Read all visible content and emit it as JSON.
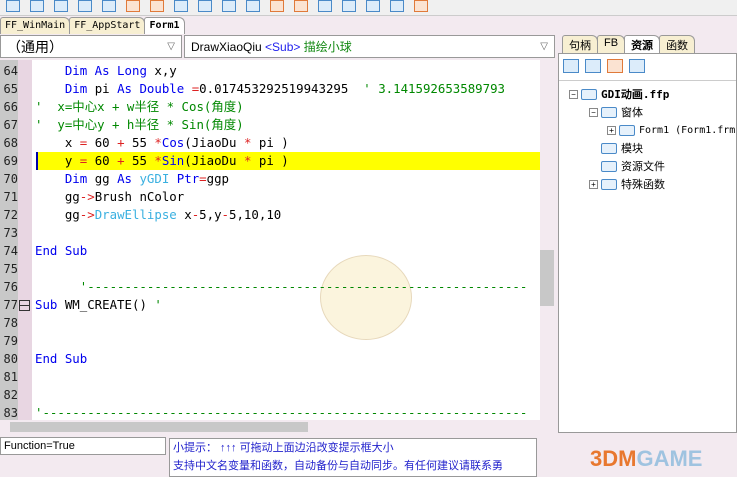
{
  "tabs": [
    "FF_WinMain",
    "FF_AppStart",
    "Form1"
  ],
  "combo_left": "（通用）",
  "combo_right": {
    "name": "DrawXiaoQiu",
    "type": "<Sub>",
    "desc": "描绘小球"
  },
  "code": [
    {
      "n": "64",
      "t": [
        [
          "    ",
          "p"
        ],
        [
          "Dim As Long ",
          "k"
        ],
        [
          "x,y",
          "p"
        ]
      ]
    },
    {
      "n": "65",
      "t": [
        [
          "    ",
          "p"
        ],
        [
          "Dim ",
          "k"
        ],
        [
          "pi ",
          "p"
        ],
        [
          "As Double ",
          "k"
        ],
        [
          "=",
          "o"
        ],
        [
          "0.017453292519943295  ",
          "p"
        ],
        [
          "' 3.141592653589793",
          "c"
        ]
      ]
    },
    {
      "n": "66",
      "t": [
        [
          "'  x=中心x + w半径 * Cos(角度)",
          "c"
        ]
      ]
    },
    {
      "n": "67",
      "t": [
        [
          "'  y=中心y + h半径 * Sin(角度)",
          "c"
        ]
      ]
    },
    {
      "n": "68",
      "t": [
        [
          "    x ",
          "p"
        ],
        [
          "= ",
          "o"
        ],
        [
          "60 ",
          "p"
        ],
        [
          "+ ",
          "o"
        ],
        [
          "55 ",
          "p"
        ],
        [
          "*",
          "o"
        ],
        [
          "Cos",
          "k"
        ],
        [
          "(JiaoDu ",
          "p"
        ],
        [
          "* ",
          "o"
        ],
        [
          "pi )",
          "p"
        ]
      ]
    },
    {
      "n": "69",
      "t": [
        [
          "    y ",
          "p"
        ],
        [
          "= ",
          "o"
        ],
        [
          "60 ",
          "p"
        ],
        [
          "+ ",
          "o"
        ],
        [
          "55 ",
          "p"
        ],
        [
          "*",
          "o"
        ],
        [
          "Sin",
          "k"
        ],
        [
          "(JiaoDu ",
          "p"
        ],
        [
          "* ",
          "o"
        ],
        [
          "pi )",
          "p"
        ]
      ],
      "hl": true
    },
    {
      "n": "70",
      "t": [
        [
          "    ",
          "p"
        ],
        [
          "Dim ",
          "k"
        ],
        [
          "gg ",
          "p"
        ],
        [
          "As ",
          "k"
        ],
        [
          "yGDI ",
          "f"
        ],
        [
          "Ptr",
          "k"
        ],
        [
          "=",
          "o"
        ],
        [
          "ggp",
          "p"
        ]
      ]
    },
    {
      "n": "71",
      "t": [
        [
          "    gg",
          "p"
        ],
        [
          "->",
          "o"
        ],
        [
          "Brush nColor",
          "p"
        ]
      ]
    },
    {
      "n": "72",
      "t": [
        [
          "    gg",
          "p"
        ],
        [
          "->",
          "o"
        ],
        [
          "DrawEllipse ",
          "f"
        ],
        [
          "x",
          "p"
        ],
        [
          "-",
          "o"
        ],
        [
          "5,y",
          "p"
        ],
        [
          "-",
          "o"
        ],
        [
          "5,10,10",
          "p"
        ]
      ]
    },
    {
      "n": "73",
      "t": []
    },
    {
      "n": "74",
      "t": [
        [
          "End Sub",
          "k"
        ]
      ]
    },
    {
      "n": "75",
      "t": []
    },
    {
      "n": "76",
      "t": [
        [
          "      '-----------------------------------------------------------",
          "c"
        ]
      ]
    },
    {
      "n": "77",
      "t": [
        [
          "Sub ",
          "k"
        ],
        [
          "WM_CREATE() ",
          "p"
        ],
        [
          "'",
          "c"
        ]
      ],
      "fold": true
    },
    {
      "n": "78",
      "t": []
    },
    {
      "n": "79",
      "t": []
    },
    {
      "n": "80",
      "t": [
        [
          "End Sub",
          "k"
        ]
      ]
    },
    {
      "n": "81",
      "t": []
    },
    {
      "n": "82",
      "t": []
    },
    {
      "n": "83",
      "t": [
        [
          "'-----------------------------------------------------------------",
          "c"
        ]
      ]
    }
  ],
  "status": "Function=True",
  "tip": [
    "小提示： ↑↑↑ 可拖动上面边沿改变提示框大小",
    "支持中文名变量和函数，自动备份与自动同步。有任何建议请联系勇"
  ],
  "right_tabs": [
    "句柄",
    "FB",
    "资源",
    "函数"
  ],
  "tree": {
    "project": "GDI动画.ffp",
    "forms": "窗体",
    "form1": "Form1 (Form1.frm",
    "modules": "模块",
    "resources": "资源文件",
    "special": "特殊函数"
  },
  "watermark": "3DMGAME"
}
